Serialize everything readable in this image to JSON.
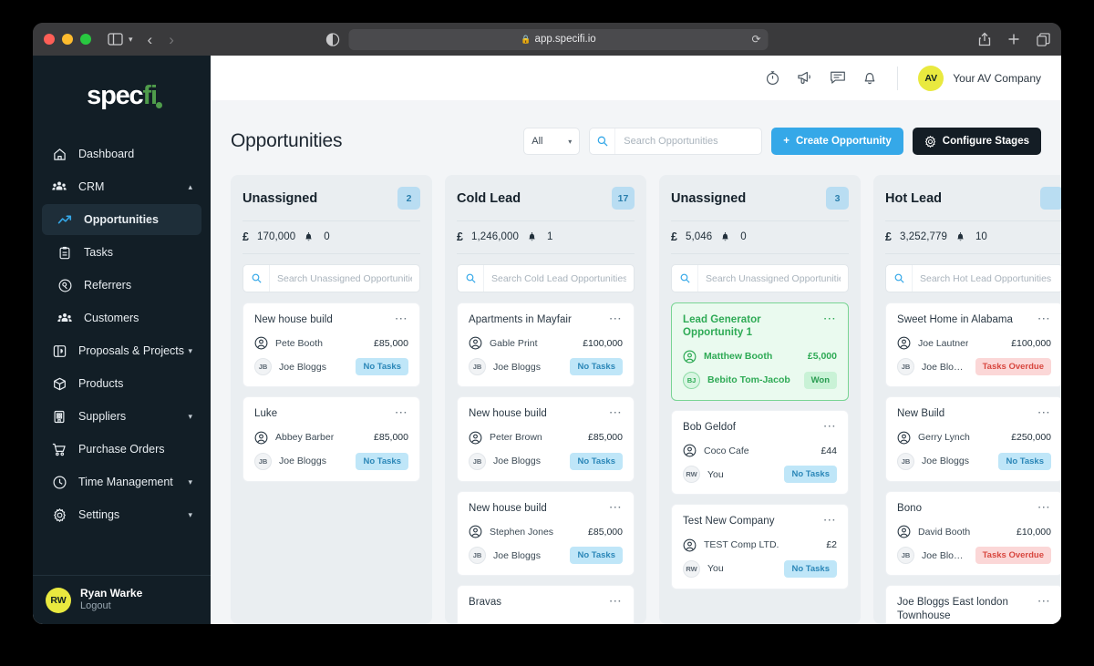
{
  "browser": {
    "url": "app.specifi.io",
    "lock_icon": "lock-icon",
    "reload_icon": "reload-icon",
    "back_icon": "back-arrow-icon",
    "forward_icon": "forward-arrow-icon",
    "sidebar_icon": "sidebar-toggle-icon",
    "reader_icon": "reader-view-icon",
    "share_icon": "share-icon",
    "newtab_icon": "new-tab-icon",
    "tabs_icon": "tab-overview-icon"
  },
  "sidebar": {
    "logo": {
      "text_a": "spec",
      "text_b": "fi",
      "dot": "logo-dot"
    },
    "items": [
      {
        "label": "Dashboard",
        "icon": "home-icon",
        "chevron": "",
        "active": false,
        "sub": false
      },
      {
        "label": "CRM",
        "icon": "people-icon",
        "chevron": "⌃",
        "active": false,
        "sub": false
      },
      {
        "label": "Opportunities",
        "icon": "trending-up-icon",
        "chevron": "",
        "active": true,
        "sub": true
      },
      {
        "label": "Tasks",
        "icon": "clipboard-icon",
        "chevron": "",
        "active": false,
        "sub": true
      },
      {
        "label": "Referrers",
        "icon": "referrer-badge-icon",
        "chevron": "",
        "active": false,
        "sub": true
      },
      {
        "label": "Customers",
        "icon": "customers-icon",
        "chevron": "",
        "active": false,
        "sub": true
      },
      {
        "label": "Proposals & Projects",
        "icon": "document-icon",
        "chevron": "⌄",
        "active": false,
        "sub": false
      },
      {
        "label": "Products",
        "icon": "box-icon",
        "chevron": "",
        "active": false,
        "sub": false
      },
      {
        "label": "Suppliers",
        "icon": "building-icon",
        "chevron": "⌄",
        "active": false,
        "sub": false
      },
      {
        "label": "Purchase Orders",
        "icon": "cart-icon",
        "chevron": "",
        "active": false,
        "sub": false
      },
      {
        "label": "Time Management",
        "icon": "clock-icon",
        "chevron": "⌄",
        "active": false,
        "sub": false
      },
      {
        "label": "Settings",
        "icon": "gear-icon",
        "chevron": "⌄",
        "active": false,
        "sub": false
      }
    ],
    "footer": {
      "initials": "RW",
      "name": "Ryan Warke",
      "logout": "Logout"
    }
  },
  "topbar": {
    "icons": [
      "timer-icon",
      "megaphone-icon",
      "chat-icon",
      "bell-icon"
    ],
    "user": {
      "initials": "AV",
      "name": "Your AV Company"
    }
  },
  "page": {
    "title": "Opportunities",
    "filter_value": "All",
    "search_placeholder": "Search Opportunities",
    "search_value": "",
    "create_label": "Create Opportunity",
    "configure_label": "Configure Stages"
  },
  "columns": [
    {
      "title": "Unassigned",
      "count": "2",
      "currency": "£",
      "total": "170,000",
      "alerts": "0",
      "search_placeholder": "Search Unassigned Opportunities",
      "cards": [
        {
          "title": "New house build",
          "contact": "Pete Booth",
          "value": "£85,000",
          "owner_initials": "JB",
          "owner": "Joe Bloggs",
          "tag": "No Tasks",
          "tag_type": "notasks",
          "won": false
        },
        {
          "title": "Luke",
          "contact": "Abbey Barber",
          "value": "£85,000",
          "owner_initials": "JB",
          "owner": "Joe Bloggs",
          "tag": "No Tasks",
          "tag_type": "notasks",
          "won": false
        }
      ]
    },
    {
      "title": "Cold Lead",
      "count": "17",
      "currency": "£",
      "total": "1,246,000",
      "alerts": "1",
      "search_placeholder": "Search Cold Lead Opportunities",
      "cards": [
        {
          "title": "Apartments in Mayfair",
          "contact": "Gable Print",
          "value": "£100,000",
          "owner_initials": "JB",
          "owner": "Joe Bloggs",
          "tag": "No Tasks",
          "tag_type": "notasks",
          "won": false
        },
        {
          "title": "New house build",
          "contact": "Peter Brown",
          "value": "£85,000",
          "owner_initials": "JB",
          "owner": "Joe Bloggs",
          "tag": "No Tasks",
          "tag_type": "notasks",
          "won": false
        },
        {
          "title": "New house build",
          "contact": "Stephen Jones",
          "value": "£85,000",
          "owner_initials": "JB",
          "owner": "Joe Bloggs",
          "tag": "No Tasks",
          "tag_type": "notasks",
          "won": false
        },
        {
          "title": "Bravas",
          "contact": "",
          "value": "",
          "owner_initials": "",
          "owner": "",
          "tag": "",
          "tag_type": "",
          "won": false
        }
      ]
    },
    {
      "title": "Unassigned",
      "count": "3",
      "currency": "£",
      "total": "5,046",
      "alerts": "0",
      "search_placeholder": "Search Unassigned Opportunities",
      "cards": [
        {
          "title": "Lead Generator Opportunity 1",
          "contact": "Matthew Booth",
          "value": "£5,000",
          "owner_initials": "BJ",
          "owner": "Bebito Tom-Jacob",
          "tag": "Won",
          "tag_type": "won",
          "won": true
        },
        {
          "title": "Bob Geldof",
          "contact": "Coco Cafe",
          "value": "£44",
          "owner_initials": "RW",
          "owner": "You",
          "tag": "No Tasks",
          "tag_type": "notasks",
          "won": false
        },
        {
          "title": "Test New Company",
          "contact": "TEST Comp LTD.",
          "value": "£2",
          "owner_initials": "RW",
          "owner": "You",
          "tag": "No Tasks",
          "tag_type": "notasks",
          "won": false
        }
      ]
    },
    {
      "title": "Hot Lead",
      "count": "",
      "currency": "£",
      "total": "3,252,779",
      "alerts": "10",
      "search_placeholder": "Search Hot Lead Opportunities",
      "cards": [
        {
          "title": "Sweet Home in Alabama",
          "contact": "Joe Lautner",
          "value": "£100,000",
          "owner_initials": "JB",
          "owner": "Joe Bloggs",
          "tag": "Tasks Overdue",
          "tag_type": "overdue",
          "won": false
        },
        {
          "title": "New Build",
          "contact": "Gerry Lynch",
          "value": "£250,000",
          "owner_initials": "JB",
          "owner": "Joe Bloggs",
          "tag": "No Tasks",
          "tag_type": "notasks",
          "won": false
        },
        {
          "title": "Bono",
          "contact": "David Booth",
          "value": "£10,000",
          "owner_initials": "JB",
          "owner": "Joe Bloggs",
          "tag": "Tasks Overdue",
          "tag_type": "overdue",
          "won": false
        },
        {
          "title": "Joe Bloggs East london Townhouse",
          "contact": "",
          "value": "",
          "owner_initials": "",
          "owner": "",
          "tag": "",
          "tag_type": "",
          "won": false
        }
      ]
    }
  ],
  "colors": {
    "sidebar_bg": "#121e26",
    "accent_blue": "#35a8e8",
    "won_green": "#2eaa55",
    "overdue_red": "#d8473f",
    "brand_green": "#4f9c4b",
    "avatar_yellow": "#e9e93f"
  }
}
